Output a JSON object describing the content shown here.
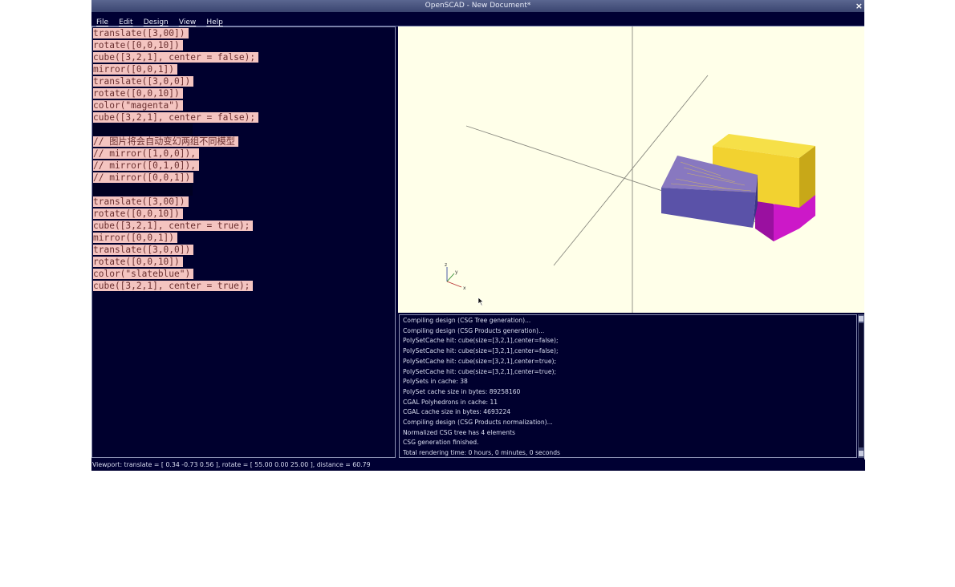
{
  "window": {
    "title": "OpenSCAD - New Document*",
    "close_glyph": "×"
  },
  "menu": [
    "File",
    "Edit",
    "Design",
    "View",
    "Help"
  ],
  "editor": {
    "lines": [
      {
        "text": "translate([3,00])",
        "kind": "code"
      },
      {
        "text": "rotate([0,0,10])",
        "kind": "code"
      },
      {
        "text": "cube([3,2,1], center = false);",
        "kind": "code"
      },
      {
        "text": "mirror([0,0,1])",
        "kind": "code"
      },
      {
        "text": "translate([3,0,0])",
        "kind": "code"
      },
      {
        "text": "rotate([0,0,10])",
        "kind": "code"
      },
      {
        "text": "color(\"magenta\")",
        "kind": "code"
      },
      {
        "text": "cube([3,2,1], center = false);",
        "kind": "code"
      },
      {
        "text": "",
        "kind": "blank"
      },
      {
        "text": "// 图片将会自动变幻两组不同模型",
        "kind": "code"
      },
      {
        "text": "// mirror([1,0,0]),",
        "kind": "code"
      },
      {
        "text": "// mirror([0,1,0]),",
        "kind": "code"
      },
      {
        "text": "// mirror([0,0,1])",
        "kind": "code"
      },
      {
        "text": "",
        "kind": "blank"
      },
      {
        "text": "translate([3,00])",
        "kind": "code"
      },
      {
        "text": "rotate([0,0,10])",
        "kind": "code"
      },
      {
        "text": "cube([3,2,1], center = true);",
        "kind": "code"
      },
      {
        "text": "mirror([0,0,1])",
        "kind": "code"
      },
      {
        "text": "translate([3,0,0])",
        "kind": "code"
      },
      {
        "text": "rotate([0,0,10])",
        "kind": "code"
      },
      {
        "text": "color(\"slateblue\")",
        "kind": "code"
      },
      {
        "text": "cube([3,2,1], center = true);",
        "kind": "code"
      }
    ]
  },
  "viewport": {
    "background": "#ffffe9",
    "axis_labels": {
      "x": "x",
      "y": "y",
      "z": "z"
    },
    "model_colors": {
      "gold": "#f2d230",
      "magenta": "#cc18c8",
      "slateblue": "#5a52a8"
    }
  },
  "console": {
    "lines": [
      "Compiling design (CSG Tree generation)...",
      "Compiling design (CSG Products generation)...",
      "PolySetCache hit: cube(size=[3,2,1],center=false);",
      "PolySetCache hit: cube(size=[3,2,1],center=false);",
      "PolySetCache hit: cube(size=[3,2,1],center=true);",
      "PolySetCache hit: cube(size=[3,2,1],center=true);",
      "PolySets in cache: 38",
      "PolySet cache size in bytes: 89258160",
      "CGAL Polyhedrons in cache: 11",
      "CGAL cache size in bytes: 4693224",
      "Compiling design (CSG Products normalization)...",
      "Normalized CSG tree has 4 elements",
      "CSG generation finished.",
      "Total rendering time: 0 hours, 0 minutes, 0 seconds"
    ]
  },
  "status": {
    "text": "Viewport: translate = [ 0.34 -0.73 0.56 ], rotate = [ 55.00 0.00 25.00 ], distance = 60.79"
  }
}
